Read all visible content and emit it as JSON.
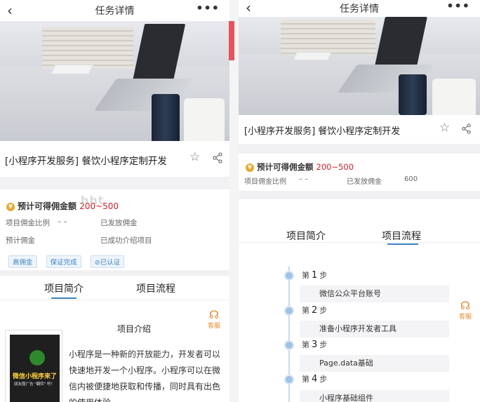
{
  "nav": {
    "title": "任务详情",
    "back_icon": "‹",
    "more_icon": "•••"
  },
  "task": {
    "title": "[小程序开发服务] 餐饮小程序定制开发"
  },
  "commission": {
    "label": "预计可得佣金额",
    "amount": "200~500",
    "coin_icon": "¥"
  },
  "details": {
    "ratio_label": "项目佣金比例",
    "ratio_value": "– –",
    "issued_label": "已发放佣金",
    "issued_value": "600",
    "expected_label": "预计佣金",
    "referred_label": "已成功介绍项目"
  },
  "tags": [
    "高佣金",
    "保证完成",
    "已认证"
  ],
  "tabs": {
    "intro": "项目简介",
    "flow": "项目流程"
  },
  "customer_service": {
    "label": "客服"
  },
  "intro": {
    "heading": "项目介绍",
    "promo_title": "微信小程序来了",
    "promo_sub": "朋友圈广告 \"翻转\" 吧！",
    "paragraph": "小程序是一种新的开放能力，开发者可以快速地开发一个小程序。小程序可以在微信内被便捷地获取和传播，同时具有出色的使用体验。"
  },
  "flow": {
    "step_prefix": "第",
    "step_suffix": "步",
    "steps": [
      {
        "num": "1",
        "label": "微信公众平台账号"
      },
      {
        "num": "2",
        "label": "准备小程序开发者工具"
      },
      {
        "num": "3",
        "label": "Page.data基础"
      },
      {
        "num": "4",
        "label": "小程序基础组件"
      }
    ]
  },
  "colors": {
    "accent": "#3b82c4",
    "amount": "#d0202c",
    "service": "#e88a2b",
    "coin": "#e9a92b"
  }
}
